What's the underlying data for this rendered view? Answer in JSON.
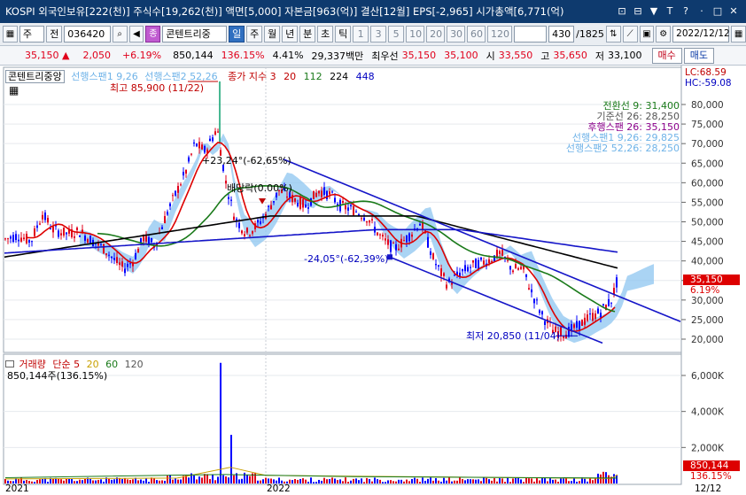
{
  "window": {
    "title": "KOSPI 외국인보유[222(천)] 주식수[19,262(천)] 액면[5,000] 자본금[963(억)] 결산[12월] EPS[-2,965] 시가총액[6,771(억)",
    "controls": [
      "⊡",
      "⊟",
      "▼",
      "T",
      "?",
      "·",
      "□",
      "✕"
    ]
  },
  "toolbar": {
    "type_select": "주",
    "prefix_label": "전",
    "code_input": "036420",
    "stock_name": "콘텐트리중",
    "periods": [
      "일",
      "주",
      "월",
      "년",
      "분",
      "초",
      "틱"
    ],
    "active_period": "일",
    "intervals": [
      "1",
      "3",
      "5",
      "10",
      "20",
      "30",
      "60",
      "120"
    ],
    "count_display": "430",
    "total_display": "/1825",
    "date_value": "2022/12/12"
  },
  "quote": {
    "price": "35,150",
    "arrow": "▲",
    "change": "2,050",
    "change_pct": "+6.19%",
    "volume": "850,144",
    "volume_ratio": "136.15%",
    "turnover": "4.41%",
    "amount": "29,337백만",
    "best_ask_label": "최우선",
    "best_ask": "35,150",
    "best_bid": "35,100",
    "open_label": "시",
    "open": "33,550",
    "high_label": "고",
    "high": "35,650",
    "low_label": "저",
    "low": "33,100",
    "buy_label": "매수",
    "sell_label": "매도"
  },
  "price_panel": {
    "legend_name": "콘텐트리중앙",
    "legend_items": [
      {
        "text": "선행스팬1 9,26",
        "color": "#6fb3e8"
      },
      {
        "text": "선행스팬2 52,26",
        "color": "#6fb3e8"
      },
      {
        "text": "종가 지수 3",
        "color": "#c00000"
      },
      {
        "text": "20",
        "color": "#c00000"
      },
      {
        "text": "112",
        "color": "#1a7a1a"
      },
      {
        "text": "224",
        "color": "#000000"
      },
      {
        "text": "448",
        "color": "#0000c0"
      }
    ],
    "lc_label": "LC:68.59",
    "hc_label": "HC:-59.08",
    "ichimoku_labels": [
      {
        "text": "전환선 9: 31,400",
        "color": "#1a7a1a"
      },
      {
        "text": "기준선 26: 28,250",
        "color": "#555555"
      },
      {
        "text": "후행스팬 26: 35,150",
        "color": "#8b008b"
      },
      {
        "text": "선행스팬1 9,26: 29,825",
        "color": "#6fb3e8"
      },
      {
        "text": "선행스팬2 52,26: 28,250",
        "color": "#6fb3e8"
      }
    ],
    "annotations": {
      "high": "최고 85,900 (11/22)",
      "low": "최저 20,850 (11/04)",
      "angle1": "+23,24°(-62,65%)",
      "angle2": "-24,05°(-62,39%)",
      "dividend": "배당락(0.00%)"
    },
    "current_price_tag": "35,150",
    "current_pct_tag": "6.19%",
    "y_ticks": [
      "80,000",
      "75,000",
      "70,000",
      "65,000",
      "60,000",
      "55,000",
      "50,000",
      "45,000",
      "40,000",
      "35,000",
      "30,000",
      "25,000",
      "20,000"
    ]
  },
  "volume_panel": {
    "legend_items": [
      {
        "text": "거래량",
        "color": "#c00000"
      },
      {
        "text": "단순 5",
        "color": "#c00000"
      },
      {
        "text": "20",
        "color": "#c8a000"
      },
      {
        "text": "60",
        "color": "#1a7a1a"
      },
      {
        "text": "120",
        "color": "#555555"
      }
    ],
    "volume_text": "850,144주(136.15%)",
    "y_ticks": [
      "6,000K",
      "4,000K",
      "2,000K"
    ],
    "volume_tag": "850,144",
    "ratio_tag": "136.15%"
  },
  "x_axis": {
    "labels": [
      "2021",
      "2022"
    ],
    "right_label": "12/12"
  },
  "colors": {
    "title_bar": "#0e3a6e",
    "up": "#e0001b",
    "down": "#0000ff",
    "cloud": "#8ec5f0",
    "ma20": "#dd0000",
    "ma112": "#1a7a1a",
    "ma224": "#000000",
    "ma448": "#1515c8",
    "trendline": "#1515c8"
  }
}
